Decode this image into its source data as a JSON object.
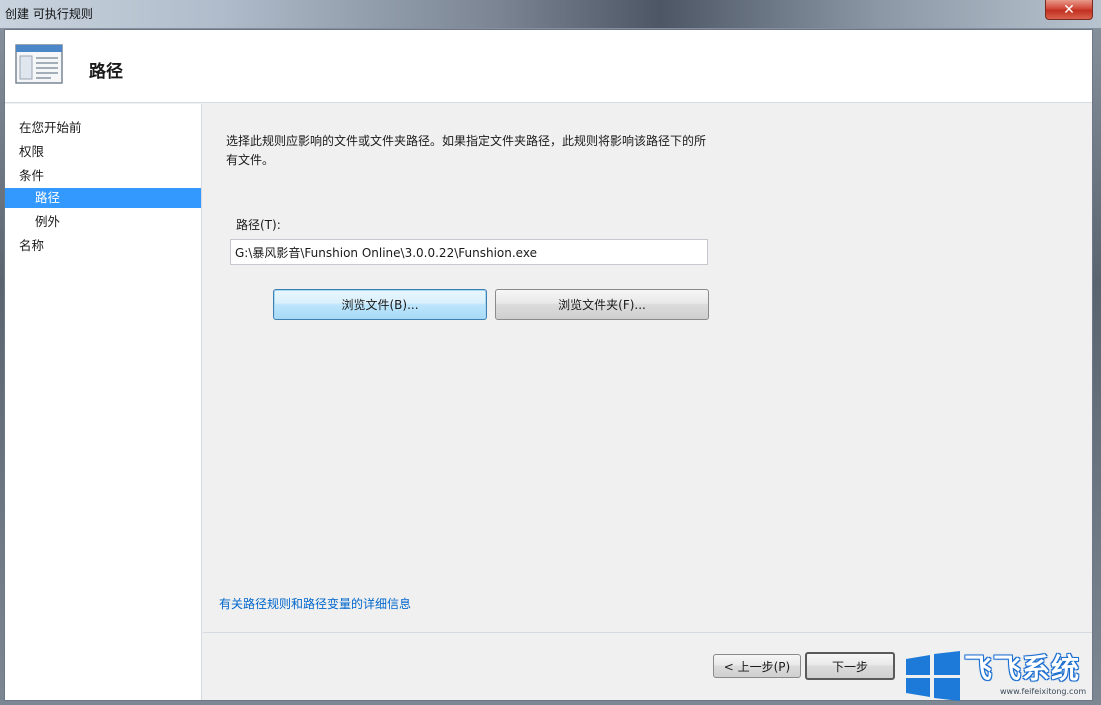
{
  "window": {
    "title": "创建 可执行规则",
    "close_glyph": "✕"
  },
  "header": {
    "title": "路径"
  },
  "nav": {
    "items": [
      {
        "label": "在您开始前",
        "level": 0,
        "selected": false
      },
      {
        "label": "权限",
        "level": 0,
        "selected": false
      },
      {
        "label": "条件",
        "level": 0,
        "selected": false
      },
      {
        "label": "路径",
        "level": 1,
        "selected": true
      },
      {
        "label": "例外",
        "level": 1,
        "selected": false
      },
      {
        "label": "名称",
        "level": 0,
        "selected": false
      }
    ]
  },
  "content": {
    "description_line1": "选择此规则应影响的文件或文件夹路径。如果指定文件夹路径，此规则将影响该路径下的所",
    "description_line2": "有文件。",
    "path_label": "路径(T):",
    "path_value": "G:\\暴风影音\\Funshion Online\\3.0.0.22\\Funshion.exe",
    "browse_file_label": "浏览文件(B)...",
    "browse_folder_label": "浏览文件夹(F)...",
    "info_link": "有关路径规则和路径变量的详细信息"
  },
  "footer": {
    "prev_label": "< 上一步(P)",
    "next_label": "下一步"
  },
  "watermark": {
    "brand": "飞飞系统",
    "url": "www.feifeixitong.com"
  },
  "colors": {
    "selection": "#3399ff",
    "link": "#0066cc",
    "close": "#c1301f"
  }
}
